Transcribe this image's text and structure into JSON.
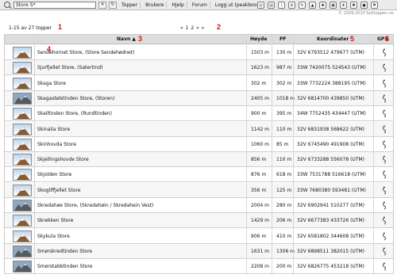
{
  "toolbar": {
    "search_value": "Store S*",
    "menu": [
      "Topper",
      "Brukere",
      "Hjelp",
      "Forum",
      "Logg ut (peakbook)"
    ],
    "icons": [
      "globe-icon",
      "map-icon",
      "info-icon",
      "list-icon",
      "edit-icon",
      "chart-icon",
      "tree-icon",
      "photo-icon",
      "star-icon",
      "settings-icon",
      "camera-icon",
      "flag-icon"
    ]
  },
  "copyright": "© 2009-2010 fjelltoppen.no",
  "summary": "1-15 av 27 topper",
  "pager": {
    "prev": "«",
    "pages": "1 2",
    "next": "»",
    "end": "»"
  },
  "annotations": [
    "1",
    "2",
    "3",
    "4",
    "5",
    "6"
  ],
  "headers": {
    "name": "Navn",
    "height": "Høyde",
    "pf": "PF",
    "coords": "Koordinater",
    "gpx": "GPX"
  },
  "rows": [
    {
      "name": "Sendehornet Store, (Store Sendehødnet)",
      "height": "1503 m",
      "pf": "130 m",
      "coords": "32V 6793512 479677 (UTM)",
      "thumb": "peak"
    },
    {
      "name": "Sjurfjellet Store, (Satertind)",
      "height": "1623 m",
      "pf": "987 m",
      "coords": "33W 7420075 524543 (UTM)",
      "thumb": "peak"
    },
    {
      "name": "Skaga Store",
      "height": "302 m",
      "pf": "302 m",
      "coords": "33W 7732224 388195 (UTM)",
      "thumb": "peak"
    },
    {
      "name": "Skagastølstinden Store, (Storen)",
      "height": "2405 m",
      "pf": "1018 m",
      "coords": "32V 6814700 439850 (UTM)",
      "thumb": "photo"
    },
    {
      "name": "Skalltinden Store, (Rundtinden)",
      "height": "900 m",
      "pf": "395 m",
      "coords": "34W 7752435 434447 (UTM)",
      "thumb": "peak"
    },
    {
      "name": "Skinalia Store",
      "height": "1142 m",
      "pf": "110 m",
      "coords": "32V 6831938 568622 (UTM)",
      "thumb": "peak"
    },
    {
      "name": "Skinhovda Store",
      "height": "1060 m",
      "pf": "85 m",
      "coords": "32V 6745490 491908 (UTM)",
      "thumb": "peak"
    },
    {
      "name": "Skjellingshovde Store",
      "height": "856 m",
      "pf": "110 m",
      "coords": "32V 6733288 556078 (UTM)",
      "thumb": "peak"
    },
    {
      "name": "Skjolden Store",
      "height": "876 m",
      "pf": "618 m",
      "coords": "33W 7531788 516618 (UTM)",
      "thumb": "peak"
    },
    {
      "name": "Skogliffjellet Store",
      "height": "356 m",
      "pf": "125 m",
      "coords": "33W 7680380 593481 (UTM)",
      "thumb": "peak"
    },
    {
      "name": "Skredahøe Store, (Skredahøin / Skredahein Vest)",
      "height": "2004 m",
      "pf": "280 m",
      "coords": "32V 6902941 510277 (UTM)",
      "thumb": "photo"
    },
    {
      "name": "Skrekken Store",
      "height": "1429 m",
      "pf": "206 m",
      "coords": "32V 6677383 433726 (UTM)",
      "thumb": "peak"
    },
    {
      "name": "Skykula Store",
      "height": "906 m",
      "pf": "410 m",
      "coords": "32V 6581802 344608 (UTM)",
      "thumb": "peak"
    },
    {
      "name": "Smørskredtinden Store",
      "height": "1631 m",
      "pf": "1306 m",
      "coords": "32V 6898511 382015 (UTM)",
      "thumb": "photo"
    },
    {
      "name": "Smørstabbtinden Store",
      "height": "2208 m",
      "pf": "200 m",
      "coords": "32V 6826775 453218 (UTM)",
      "thumb": "photo"
    }
  ]
}
